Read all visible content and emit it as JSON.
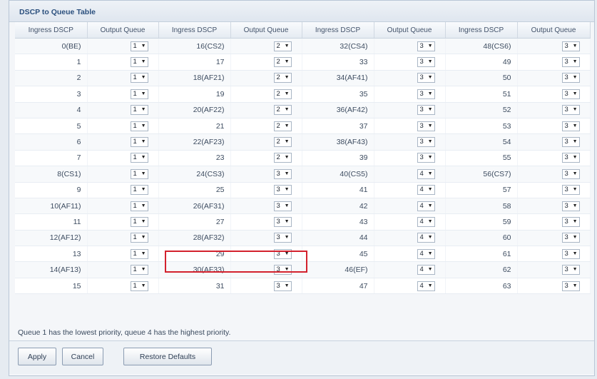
{
  "panel": {
    "title": "DSCP to Queue Table"
  },
  "table": {
    "headers": [
      "Ingress DSCP",
      "Output Queue",
      "Ingress DSCP",
      "Output Queue",
      "Ingress DSCP",
      "Output Queue",
      "Ingress DSCP",
      "Output Queue"
    ],
    "rows": [
      [
        {
          "dscp": "0(BE)",
          "queue": "1"
        },
        {
          "dscp": "16(CS2)",
          "queue": "2"
        },
        {
          "dscp": "32(CS4)",
          "queue": "3"
        },
        {
          "dscp": "48(CS6)",
          "queue": "3"
        }
      ],
      [
        {
          "dscp": "1",
          "queue": "1"
        },
        {
          "dscp": "17",
          "queue": "2"
        },
        {
          "dscp": "33",
          "queue": "3"
        },
        {
          "dscp": "49",
          "queue": "3"
        }
      ],
      [
        {
          "dscp": "2",
          "queue": "1"
        },
        {
          "dscp": "18(AF21)",
          "queue": "2"
        },
        {
          "dscp": "34(AF41)",
          "queue": "3"
        },
        {
          "dscp": "50",
          "queue": "3"
        }
      ],
      [
        {
          "dscp": "3",
          "queue": "1"
        },
        {
          "dscp": "19",
          "queue": "2"
        },
        {
          "dscp": "35",
          "queue": "3"
        },
        {
          "dscp": "51",
          "queue": "3"
        }
      ],
      [
        {
          "dscp": "4",
          "queue": "1"
        },
        {
          "dscp": "20(AF22)",
          "queue": "2"
        },
        {
          "dscp": "36(AF42)",
          "queue": "3"
        },
        {
          "dscp": "52",
          "queue": "3"
        }
      ],
      [
        {
          "dscp": "5",
          "queue": "1"
        },
        {
          "dscp": "21",
          "queue": "2"
        },
        {
          "dscp": "37",
          "queue": "3"
        },
        {
          "dscp": "53",
          "queue": "3"
        }
      ],
      [
        {
          "dscp": "6",
          "queue": "1"
        },
        {
          "dscp": "22(AF23)",
          "queue": "2"
        },
        {
          "dscp": "38(AF43)",
          "queue": "3"
        },
        {
          "dscp": "54",
          "queue": "3"
        }
      ],
      [
        {
          "dscp": "7",
          "queue": "1"
        },
        {
          "dscp": "23",
          "queue": "2"
        },
        {
          "dscp": "39",
          "queue": "3"
        },
        {
          "dscp": "55",
          "queue": "3"
        }
      ],
      [
        {
          "dscp": "8(CS1)",
          "queue": "1"
        },
        {
          "dscp": "24(CS3)",
          "queue": "3"
        },
        {
          "dscp": "40(CS5)",
          "queue": "4"
        },
        {
          "dscp": "56(CS7)",
          "queue": "3"
        }
      ],
      [
        {
          "dscp": "9",
          "queue": "1"
        },
        {
          "dscp": "25",
          "queue": "3"
        },
        {
          "dscp": "41",
          "queue": "4"
        },
        {
          "dscp": "57",
          "queue": "3"
        }
      ],
      [
        {
          "dscp": "10(AF11)",
          "queue": "1"
        },
        {
          "dscp": "26(AF31)",
          "queue": "3"
        },
        {
          "dscp": "42",
          "queue": "4"
        },
        {
          "dscp": "58",
          "queue": "3"
        }
      ],
      [
        {
          "dscp": "11",
          "queue": "1"
        },
        {
          "dscp": "27",
          "queue": "3"
        },
        {
          "dscp": "43",
          "queue": "4"
        },
        {
          "dscp": "59",
          "queue": "3"
        }
      ],
      [
        {
          "dscp": "12(AF12)",
          "queue": "1"
        },
        {
          "dscp": "28(AF32)",
          "queue": "3"
        },
        {
          "dscp": "44",
          "queue": "4"
        },
        {
          "dscp": "60",
          "queue": "3"
        }
      ],
      [
        {
          "dscp": "13",
          "queue": "1"
        },
        {
          "dscp": "29",
          "queue": "3"
        },
        {
          "dscp": "45",
          "queue": "4"
        },
        {
          "dscp": "61",
          "queue": "3"
        }
      ],
      [
        {
          "dscp": "14(AF13)",
          "queue": "1"
        },
        {
          "dscp": "30(AF33)",
          "queue": "3"
        },
        {
          "dscp": "46(EF)",
          "queue": "4"
        },
        {
          "dscp": "62",
          "queue": "3"
        }
      ],
      [
        {
          "dscp": "15",
          "queue": "1"
        },
        {
          "dscp": "31",
          "queue": "3"
        },
        {
          "dscp": "47",
          "queue": "4"
        },
        {
          "dscp": "63",
          "queue": "3"
        }
      ]
    ],
    "dropdown_icon": "chevron-down-icon",
    "highlight_color": "#d3212d"
  },
  "note": "Queue 1 has the lowest priority, queue 4 has the highest priority.",
  "buttons": {
    "apply": "Apply",
    "cancel": "Cancel",
    "restore": "Restore Defaults"
  }
}
